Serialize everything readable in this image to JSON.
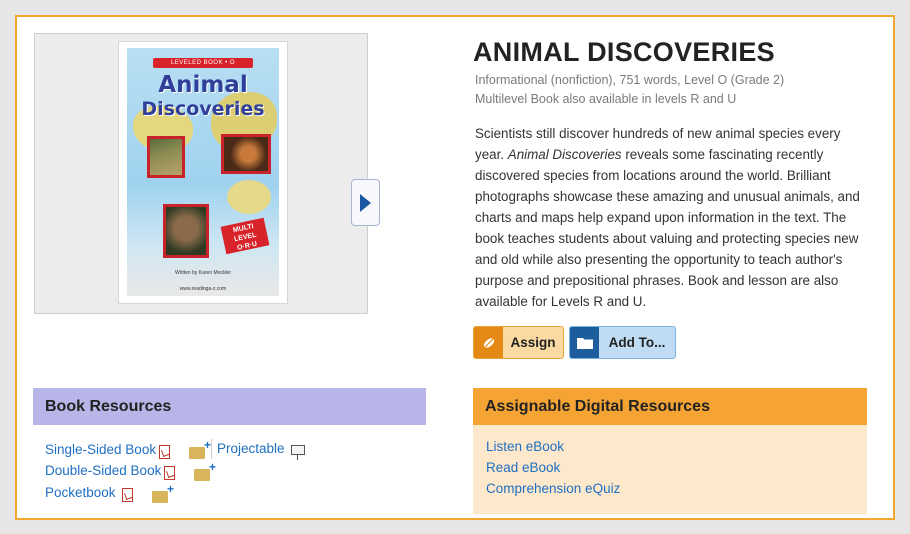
{
  "book": {
    "title": "ANIMAL DISCOVERIES",
    "meta_line1": "Informational (nonfiction), 751 words, Level O (Grade 2)",
    "meta_line2": "Multilevel Book also available in levels R and U",
    "description_part1": "Scientists still discover hundreds of new animal species every year. ",
    "description_italic": "Animal Discoveries",
    "description_part2": " reveals some fascinating recently discovered species from locations around the world. Brilliant photographs showcase these amazing and unusual animals, and charts and maps help expand upon information in the text. The book teaches students about valuing and protecting species new and old while also presenting the opportunity to teach author's purpose and prepositional phrases. Book and lesson are also available for Levels R and U."
  },
  "cover": {
    "banner": "LEVELED BOOK • O",
    "title_line1": "Animal",
    "title_line2": "Discoveries",
    "badge": "MULTI LEVEL O·R·U",
    "author": "Written by Karen Mockler",
    "url": "www.readinga-z.com"
  },
  "actions": {
    "assign_label": "Assign",
    "addto_label": "Add To..."
  },
  "book_resources": {
    "heading": "Book Resources",
    "single_sided": "Single-Sided Book",
    "double_sided": "Double-Sided Book",
    "pocketbook": "Pocketbook",
    "projectable": "Projectable"
  },
  "digital_resources": {
    "heading": "Assignable Digital Resources",
    "items": [
      "Listen eBook",
      "Read eBook",
      "Comprehension eQuiz"
    ]
  },
  "colors": {
    "frame_border": "#f0a92e",
    "book_header": "#b8b5e8",
    "digital_header": "#f5a333",
    "digital_body": "#fde8cb",
    "link": "#1f6fc2"
  }
}
